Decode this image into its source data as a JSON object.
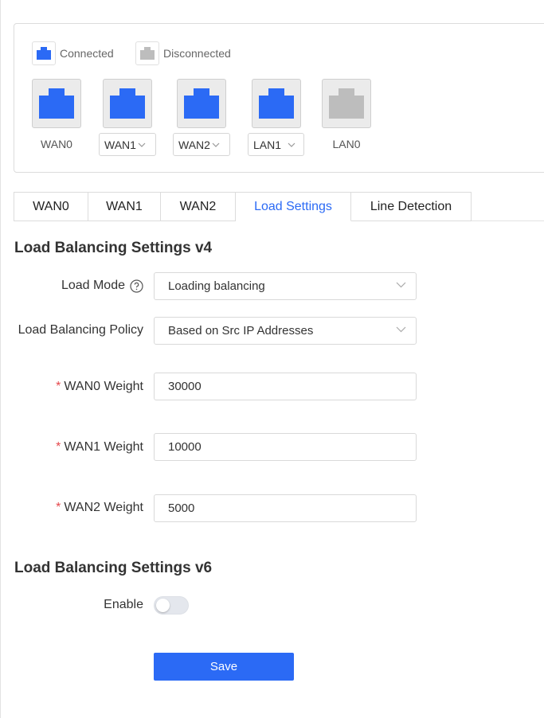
{
  "legend": {
    "connected_label": "Connected",
    "disconnected_label": "Disconnected",
    "connected_color": "#2b6af5",
    "disconnected_color": "#bdbdbd"
  },
  "ports": [
    {
      "label": "WAN0",
      "status": "connected",
      "selectable": false
    },
    {
      "label": "WAN1",
      "status": "connected",
      "selectable": true
    },
    {
      "label": "WAN2",
      "status": "connected",
      "selectable": true
    },
    {
      "label": "LAN1",
      "status": "connected",
      "selectable": true
    },
    {
      "label": "LAN0",
      "status": "disconnected",
      "selectable": false
    }
  ],
  "tabs": [
    {
      "label": "WAN0",
      "active": false
    },
    {
      "label": "WAN1",
      "active": false
    },
    {
      "label": "WAN2",
      "active": false
    },
    {
      "label": "Load Settings",
      "active": true
    },
    {
      "label": "Line Detection",
      "active": false
    }
  ],
  "v4": {
    "title": "Load Balancing Settings v4",
    "load_mode_label": "Load Mode",
    "load_mode_value": "Loading balancing",
    "policy_label": "Load Balancing Policy",
    "policy_value": "Based on Src IP Addresses",
    "wan0_weight_label": "WAN0 Weight",
    "wan0_weight_value": "30000",
    "wan1_weight_label": "WAN1 Weight",
    "wan1_weight_value": "10000",
    "wan2_weight_label": "WAN2 Weight",
    "wan2_weight_value": "5000",
    "required_mark": "*"
  },
  "v6": {
    "title": "Load Balancing Settings v6",
    "enable_label": "Enable",
    "enabled": false
  },
  "save_label": "Save",
  "accent_color": "#2b6af5"
}
